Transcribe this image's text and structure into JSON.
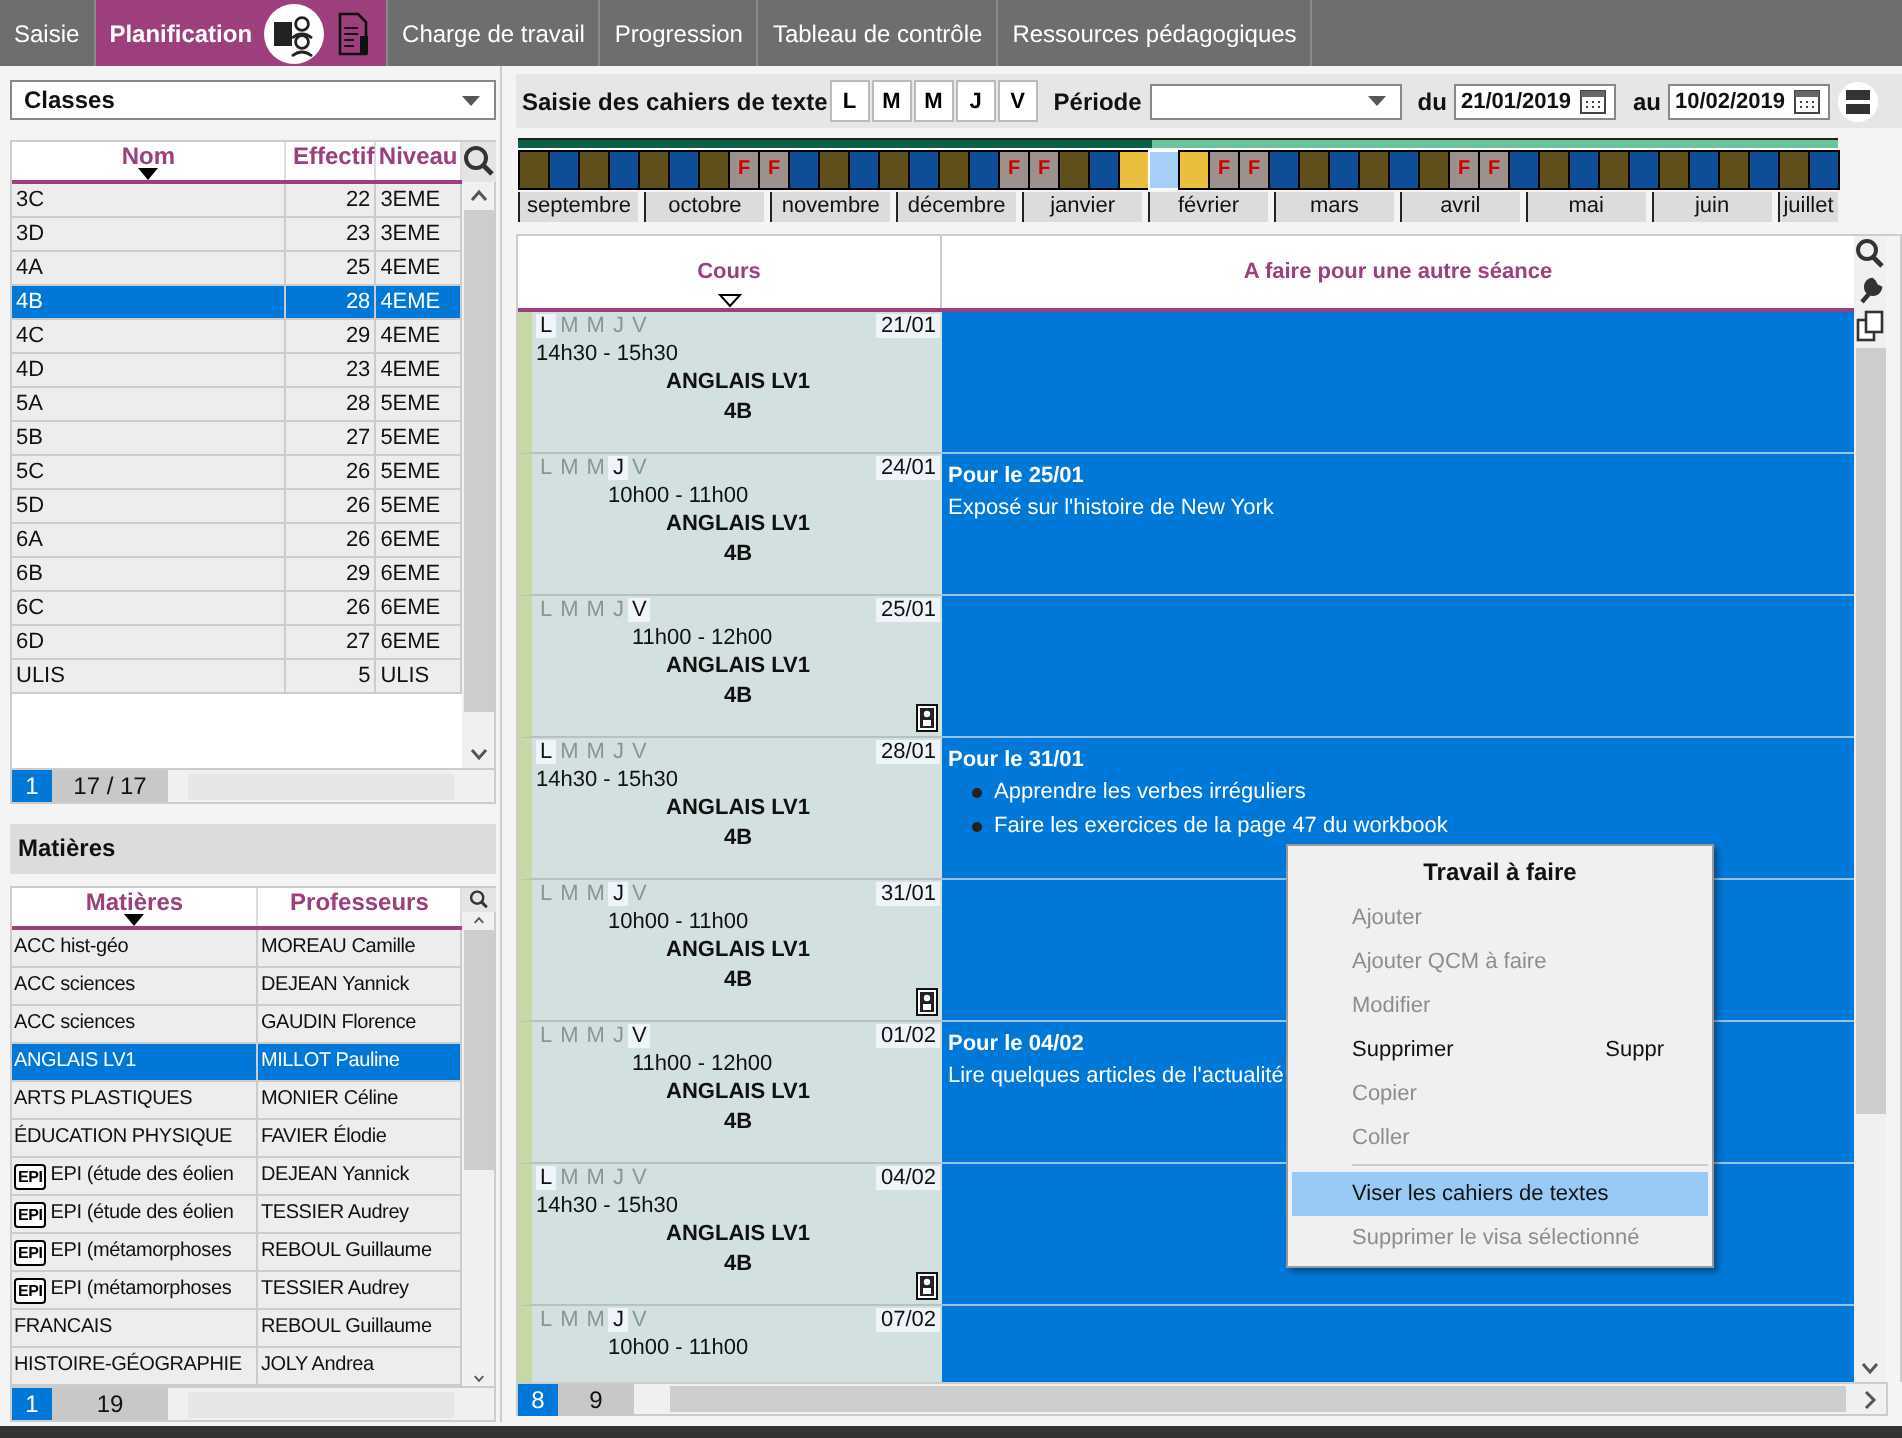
{
  "tabs": [
    {
      "label": "Saisie",
      "selected": false
    },
    {
      "label": "Planification",
      "selected": true
    },
    {
      "label": "Charge de travail",
      "selected": false
    },
    {
      "label": "Progression",
      "selected": false
    },
    {
      "label": "Tableau de contrôle",
      "selected": false
    },
    {
      "label": "Ressources pédagogiques",
      "selected": false
    }
  ],
  "left": {
    "selector": {
      "value": "Classes"
    },
    "classes_table": {
      "columns": [
        "Nom",
        "Effectif",
        "Niveau"
      ],
      "rows": [
        {
          "cells": [
            "3C",
            "22",
            "3EME"
          ],
          "selected": false
        },
        {
          "cells": [
            "3D",
            "23",
            "3EME"
          ],
          "selected": false
        },
        {
          "cells": [
            "4A",
            "25",
            "4EME"
          ],
          "selected": false
        },
        {
          "cells": [
            "4B",
            "28",
            "4EME"
          ],
          "selected": true
        },
        {
          "cells": [
            "4C",
            "29",
            "4EME"
          ],
          "selected": false
        },
        {
          "cells": [
            "4D",
            "23",
            "4EME"
          ],
          "selected": false
        },
        {
          "cells": [
            "5A",
            "28",
            "5EME"
          ],
          "selected": false
        },
        {
          "cells": [
            "5B",
            "27",
            "5EME"
          ],
          "selected": false
        },
        {
          "cells": [
            "5C",
            "26",
            "5EME"
          ],
          "selected": false
        },
        {
          "cells": [
            "5D",
            "26",
            "5EME"
          ],
          "selected": false
        },
        {
          "cells": [
            "6A",
            "26",
            "6EME"
          ],
          "selected": false
        },
        {
          "cells": [
            "6B",
            "29",
            "6EME"
          ],
          "selected": false
        },
        {
          "cells": [
            "6C",
            "26",
            "6EME"
          ],
          "selected": false
        },
        {
          "cells": [
            "6D",
            "27",
            "6EME"
          ],
          "selected": false
        },
        {
          "cells": [
            "ULIS",
            "5",
            "ULIS"
          ],
          "selected": false
        }
      ],
      "footer": {
        "page": "1",
        "count": "17 / 17"
      }
    },
    "section_title": "Matières",
    "subjects_table": {
      "columns": [
        "Matières",
        "Professeurs"
      ],
      "rows": [
        {
          "subject": "ACC hist-géo",
          "teacher": "MOREAU Camille",
          "selected": false
        },
        {
          "subject": "ACC sciences",
          "teacher": "DEJEAN Yannick",
          "selected": false
        },
        {
          "subject": "ACC sciences",
          "teacher": "GAUDIN Florence",
          "selected": false
        },
        {
          "subject": "ANGLAIS LV1",
          "teacher": "MILLOT Pauline",
          "selected": true
        },
        {
          "subject": "ARTS PLASTIQUES",
          "teacher": "MONIER Céline",
          "selected": false
        },
        {
          "subject": "ÉDUCATION PHYSIQUE",
          "teacher": "FAVIER Élodie",
          "selected": false
        },
        {
          "badge": "EPI",
          "subject": "EPI (étude des éolien",
          "teacher": "DEJEAN Yannick",
          "selected": false
        },
        {
          "badge": "EPI",
          "subject": "EPI (étude des éolien",
          "teacher": "TESSIER Audrey",
          "selected": false
        },
        {
          "badge": "EPI",
          "subject": "EPI (métamorphoses",
          "teacher": "REBOUL Guillaume",
          "selected": false
        },
        {
          "badge": "EPI",
          "subject": "EPI (métamorphoses",
          "teacher": "TESSIER Audrey",
          "selected": false
        },
        {
          "subject": "FRANCAIS",
          "teacher": "REBOUL Guillaume",
          "selected": false
        },
        {
          "subject": "HISTOIRE-GÉOGRAPHIE",
          "teacher": "JOLY Andrea",
          "selected": false
        }
      ],
      "footer": {
        "page": "1",
        "count": "19"
      }
    }
  },
  "toolbar": {
    "title": "Saisie des cahiers de texte",
    "days": [
      "L",
      "M",
      "M",
      "J",
      "V"
    ],
    "period_label": "Période",
    "from_label": "du",
    "from": "21/01/2019",
    "to_label": "au",
    "to": "10/02/2019"
  },
  "timeline": {
    "progress": {
      "level": 0.48
    },
    "weeks": [
      {
        "kind": "a"
      },
      {
        "kind": "b"
      },
      {
        "kind": "a"
      },
      {
        "kind": "b"
      },
      {
        "kind": "a"
      },
      {
        "kind": "b"
      },
      {
        "kind": "a"
      },
      {
        "kind": "holiday",
        "label": "F"
      },
      {
        "kind": "holiday",
        "label": "F"
      },
      {
        "kind": "b"
      },
      {
        "kind": "a"
      },
      {
        "kind": "b"
      },
      {
        "kind": "a"
      },
      {
        "kind": "b"
      },
      {
        "kind": "a"
      },
      {
        "kind": "b"
      },
      {
        "kind": "holiday",
        "label": "F"
      },
      {
        "kind": "holiday",
        "label": "F"
      },
      {
        "kind": "a"
      },
      {
        "kind": "b"
      },
      {
        "kind": "range"
      },
      {
        "kind": "current"
      },
      {
        "kind": "range"
      },
      {
        "kind": "holiday",
        "label": "F"
      },
      {
        "kind": "holiday",
        "label": "F"
      },
      {
        "kind": "b"
      },
      {
        "kind": "a"
      },
      {
        "kind": "b"
      },
      {
        "kind": "a"
      },
      {
        "kind": "b"
      },
      {
        "kind": "a"
      },
      {
        "kind": "holiday",
        "label": "F"
      },
      {
        "kind": "holiday",
        "label": "F"
      },
      {
        "kind": "b"
      },
      {
        "kind": "a"
      },
      {
        "kind": "b"
      },
      {
        "kind": "a"
      },
      {
        "kind": "b"
      },
      {
        "kind": "a"
      },
      {
        "kind": "b"
      },
      {
        "kind": "a"
      },
      {
        "kind": "b"
      },
      {
        "kind": "a"
      },
      {
        "kind": "b"
      }
    ],
    "months": [
      "septembre",
      "octobre",
      "novembre",
      "décembre",
      "janvier",
      "février",
      "mars",
      "avril",
      "mai",
      "juin",
      "juillet"
    ]
  },
  "grid": {
    "columns": [
      "Cours",
      "A faire pour une autre séance"
    ],
    "rows": [
      {
        "days": [
          {
            "label": "L",
            "selected": true
          },
          {
            "label": "M",
            "selected": false
          },
          {
            "label": "M",
            "selected": false
          },
          {
            "label": "J",
            "selected": false
          },
          {
            "label": "V",
            "selected": false
          }
        ],
        "date": "21/01",
        "time": "14h30 - 15h30",
        "subject": "ANGLAIS LV1",
        "class": "4B",
        "visa": false
      },
      {
        "days": [
          {
            "label": "L",
            "selected": false
          },
          {
            "label": "M",
            "selected": false
          },
          {
            "label": "M",
            "selected": false
          },
          {
            "label": "J",
            "selected": true
          },
          {
            "label": "V",
            "selected": false
          }
        ],
        "date": "24/01",
        "time": "10h00 - 11h00",
        "subject": "ANGLAIS LV1",
        "class": "4B",
        "visa": false,
        "due": "Pour le 25/01",
        "work": [
          {
            "kind": "text",
            "text": "Exposé sur l'histoire de New York"
          }
        ]
      },
      {
        "days": [
          {
            "label": "L",
            "selected": false
          },
          {
            "label": "M",
            "selected": false
          },
          {
            "label": "M",
            "selected": false
          },
          {
            "label": "J",
            "selected": false
          },
          {
            "label": "V",
            "selected": true
          }
        ],
        "date": "25/01",
        "time": "11h00 - 12h00",
        "subject": "ANGLAIS LV1",
        "class": "4B",
        "visa": true
      },
      {
        "days": [
          {
            "label": "L",
            "selected": true
          },
          {
            "label": "M",
            "selected": false
          },
          {
            "label": "M",
            "selected": false
          },
          {
            "label": "J",
            "selected": false
          },
          {
            "label": "V",
            "selected": false
          }
        ],
        "date": "28/01",
        "time": "14h30 - 15h30",
        "subject": "ANGLAIS LV1",
        "class": "4B",
        "visa": false,
        "due": "Pour le 31/01",
        "work": [
          {
            "kind": "bullet",
            "text": "Apprendre les verbes irréguliers"
          },
          {
            "kind": "bullet",
            "text": "Faire les exercices de la page 47 du workbook"
          }
        ]
      },
      {
        "days": [
          {
            "label": "L",
            "selected": false
          },
          {
            "label": "M",
            "selected": false
          },
          {
            "label": "M",
            "selected": false
          },
          {
            "label": "J",
            "selected": true
          },
          {
            "label": "V",
            "selected": false
          }
        ],
        "date": "31/01",
        "time": "10h00 - 11h00",
        "subject": "ANGLAIS LV1",
        "class": "4B",
        "visa": true
      },
      {
        "days": [
          {
            "label": "L",
            "selected": false
          },
          {
            "label": "M",
            "selected": false
          },
          {
            "label": "M",
            "selected": false
          },
          {
            "label": "J",
            "selected": false
          },
          {
            "label": "V",
            "selected": true
          }
        ],
        "date": "01/02",
        "time": "11h00 - 12h00",
        "subject": "ANGLAIS LV1",
        "class": "4B",
        "visa": false,
        "due": "Pour le 04/02",
        "work": [
          {
            "kind": "text",
            "text": "Lire quelques articles de l'actualité"
          }
        ]
      },
      {
        "days": [
          {
            "label": "L",
            "selected": true
          },
          {
            "label": "M",
            "selected": false
          },
          {
            "label": "M",
            "selected": false
          },
          {
            "label": "J",
            "selected": false
          },
          {
            "label": "V",
            "selected": false
          }
        ],
        "date": "04/02",
        "time": "14h30 - 15h30",
        "subject": "ANGLAIS LV1",
        "class": "4B",
        "visa": true
      },
      {
        "days": [
          {
            "label": "L",
            "selected": false
          },
          {
            "label": "M",
            "selected": false
          },
          {
            "label": "M",
            "selected": false
          },
          {
            "label": "J",
            "selected": true
          },
          {
            "label": "V",
            "selected": false
          }
        ],
        "date": "07/02",
        "time": "10h00 - 11h00",
        "visa": false
      }
    ],
    "footer": {
      "page": "8",
      "count": "9"
    }
  },
  "context_menu": {
    "title": "Travail à faire",
    "items": [
      {
        "kind": "item",
        "label": "Ajouter",
        "disabled": true,
        "selected": false
      },
      {
        "kind": "item",
        "label": "Ajouter QCM à faire",
        "disabled": true,
        "selected": false
      },
      {
        "kind": "item",
        "label": "Modifier",
        "disabled": true,
        "selected": false
      },
      {
        "kind": "item",
        "label": "Supprimer",
        "shortcut": "Suppr",
        "disabled": false,
        "selected": false
      },
      {
        "kind": "item",
        "label": "Copier",
        "disabled": true,
        "selected": false
      },
      {
        "kind": "item",
        "label": "Coller",
        "disabled": true,
        "selected": false
      },
      {
        "kind": "separator"
      },
      {
        "kind": "item",
        "label": "Viser les cahiers de textes",
        "disabled": false,
        "selected": true
      },
      {
        "kind": "item",
        "label": "Supprimer le visa sélectionné",
        "disabled": true,
        "selected": false
      }
    ]
  }
}
